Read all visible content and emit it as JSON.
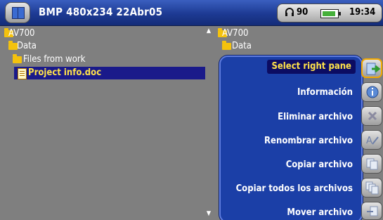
{
  "topbar": {
    "title": "BMP 480x234 22Abr05",
    "volume": "90",
    "clock": "19:34"
  },
  "left_pane": {
    "items": [
      {
        "label": "AV700",
        "type": "folder"
      },
      {
        "label": "Data",
        "type": "folder"
      },
      {
        "label": "Files from work",
        "type": "folder"
      },
      {
        "label": "Project info.doc",
        "type": "document",
        "selected": true
      }
    ]
  },
  "right_pane": {
    "items": [
      {
        "label": "AV700",
        "type": "folder"
      },
      {
        "label": "Data",
        "type": "folder"
      }
    ]
  },
  "menu": {
    "items": [
      {
        "label": "Select right pane",
        "icon": "arrow-right-icon",
        "selected": true
      },
      {
        "label": "Información",
        "icon": "info-icon"
      },
      {
        "label": "Eliminar archivo",
        "icon": "delete-x-icon"
      },
      {
        "label": "Renombrar archivo",
        "icon": "rename-pen-icon"
      },
      {
        "label": "Copiar archivo",
        "icon": "copy-file-icon"
      },
      {
        "label": "Copiar todos los archivos",
        "icon": "copy-all-icon"
      },
      {
        "label": "Mover archivo",
        "icon": "move-file-icon"
      }
    ]
  },
  "colors": {
    "background": "#7f7f7f",
    "header": "#1d3a93",
    "menu": "#1b3fa7",
    "highlight_text": "#ffe24a",
    "selection": "#1a1a8a"
  }
}
